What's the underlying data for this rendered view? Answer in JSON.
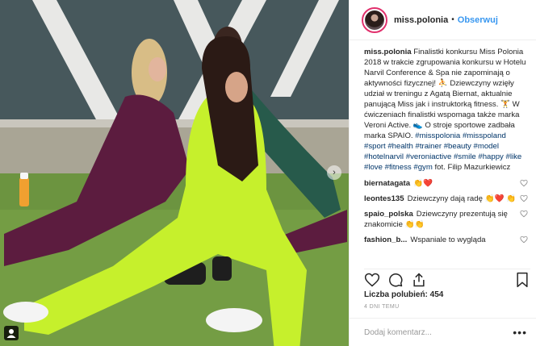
{
  "post": {
    "image_alt": "Finalistki konkursu Miss Polonia ćwiczące na trawie",
    "author": "miss.polonia",
    "dot": "•",
    "follow_label": "Obserwuj",
    "caption_user": "miss.polonia",
    "caption_parts": [
      {
        "t": "text",
        "v": " Finalistki konkursu Miss Polonia 2018 w trakcie zgrupowania konkursu w Hotelu Narvil Conference & Spa nie zapominają o aktywności fizycznej! "
      },
      {
        "t": "text",
        "v": "⛹️ Dziewczyny wzięły udział w treningu z Agatą Biernat, aktualnie panującą Miss jak i instruktorką fitness. 🏋️ W ćwiczeniach finalistki wspomaga także marka Veroni Active. 👟 O stroje sportowe zadbała marka SPAIO. "
      },
      {
        "t": "tag",
        "v": "#misspolonia"
      },
      {
        "t": "text",
        "v": " "
      },
      {
        "t": "tag",
        "v": "#misspoland"
      },
      {
        "t": "text",
        "v": " "
      },
      {
        "t": "tag",
        "v": "#sport"
      },
      {
        "t": "text",
        "v": " "
      },
      {
        "t": "tag",
        "v": "#health"
      },
      {
        "t": "text",
        "v": " "
      },
      {
        "t": "tag",
        "v": "#trainer"
      },
      {
        "t": "text",
        "v": " "
      },
      {
        "t": "tag",
        "v": "#beauty"
      },
      {
        "t": "text",
        "v": " "
      },
      {
        "t": "tag",
        "v": "#model"
      },
      {
        "t": "text",
        "v": " "
      },
      {
        "t": "tag",
        "v": "#hotelnarvil"
      },
      {
        "t": "text",
        "v": " "
      },
      {
        "t": "tag",
        "v": "#veroniactive"
      },
      {
        "t": "text",
        "v": " "
      },
      {
        "t": "tag",
        "v": "#smile"
      },
      {
        "t": "text",
        "v": " "
      },
      {
        "t": "tag",
        "v": "#happy"
      },
      {
        "t": "text",
        "v": " "
      },
      {
        "t": "tag",
        "v": "#like"
      },
      {
        "t": "text",
        "v": " "
      },
      {
        "t": "tag",
        "v": "#love"
      },
      {
        "t": "text",
        "v": " "
      },
      {
        "t": "tag",
        "v": "#fitness"
      },
      {
        "t": "text",
        "v": " "
      },
      {
        "t": "tag",
        "v": "#gym"
      },
      {
        "t": "text",
        "v": " fot. Filip Mazurkiewicz"
      }
    ],
    "comments": [
      {
        "user": "biernatagata",
        "text": "👏❤️"
      },
      {
        "user": "leontes135",
        "text": "Dziewczyny dają radę 👏❤️ 👏"
      },
      {
        "user": "spaio_polska",
        "text": "Dziewczyny prezentują się znakomicie 👏👏"
      },
      {
        "user": "fashion_b...",
        "text": "Wspaniale to wygląda"
      }
    ],
    "likes_label": "Liczba polubień:",
    "likes_count": "454",
    "time_ago": "4 DNI TEMU",
    "comment_placeholder": "Dodaj komentarz...",
    "more_label": "•••",
    "next_arrow": "›"
  },
  "icons": {
    "heart": "heart-icon",
    "comment": "comment-icon",
    "share": "share-icon",
    "bookmark": "bookmark-icon",
    "user_tag": "user-tag-icon"
  },
  "colors": {
    "follow_blue": "#3897f0",
    "hashtag": "#003569",
    "story_ring": "#e1306c"
  }
}
